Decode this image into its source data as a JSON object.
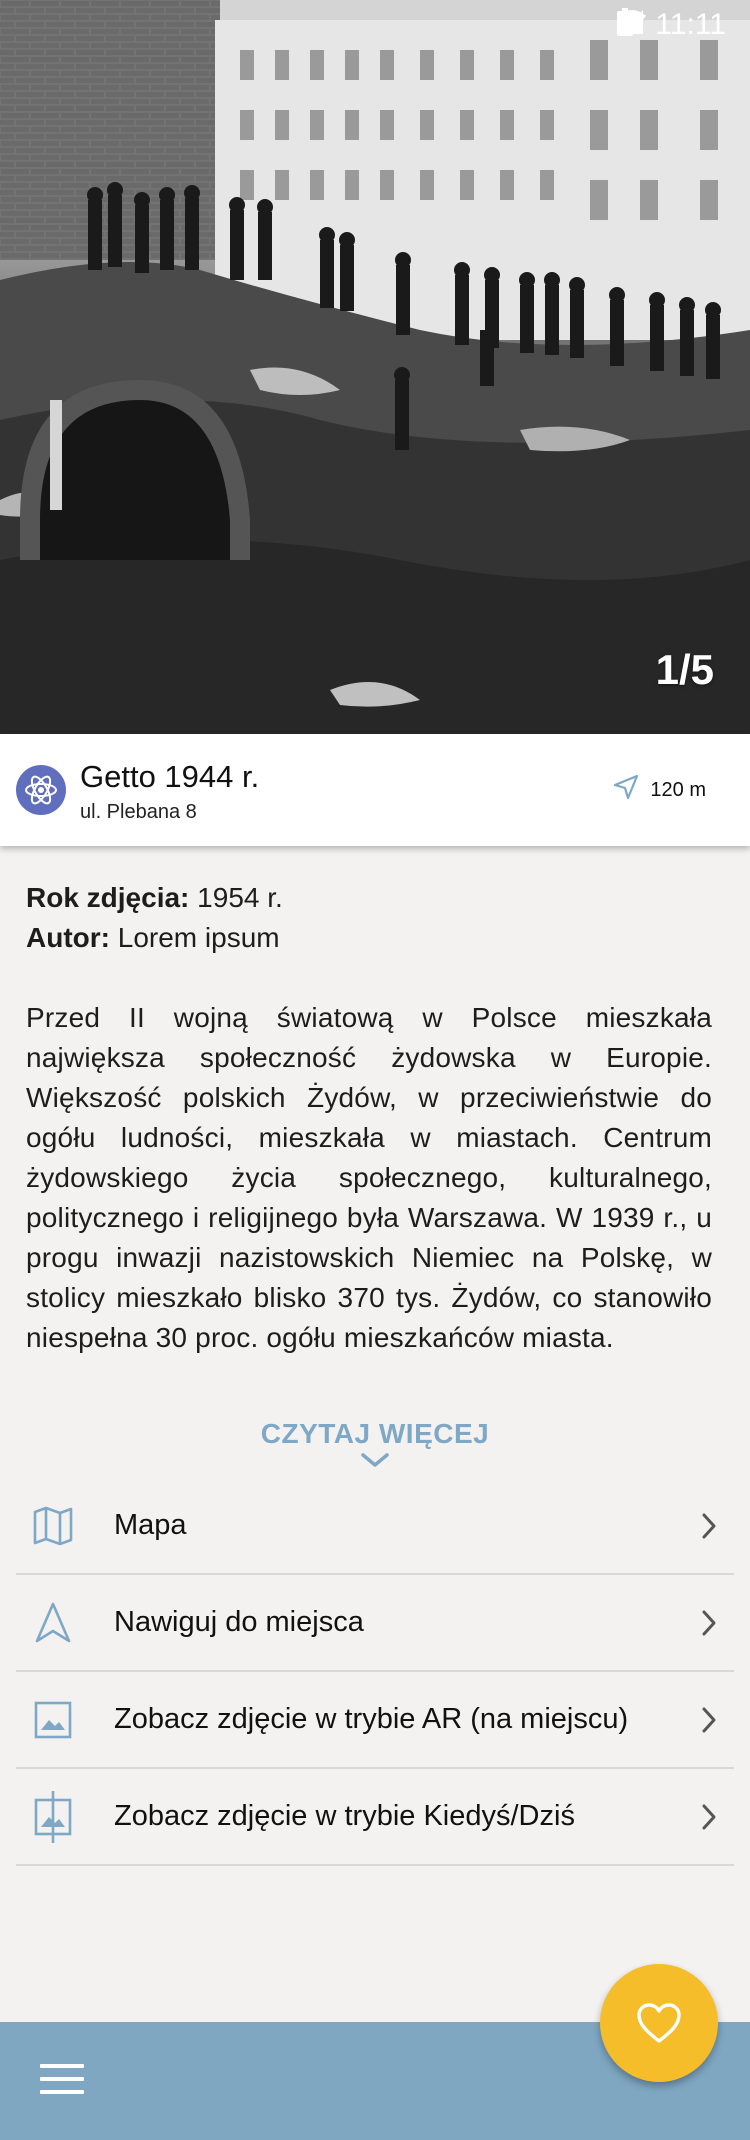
{
  "status_bar": {
    "time": "11:11",
    "icons": [
      "wifi-icon",
      "signal-icon",
      "battery-icon"
    ]
  },
  "photo": {
    "counter": "1/5",
    "description_hint": "historic black-and-white photograph"
  },
  "place": {
    "title": "Getto 1944 r.",
    "address": "ul. Plebana 8",
    "distance": "120 m",
    "logo_icon": "atom-flower-icon"
  },
  "details": {
    "year_label": "Rok zdjęcia:",
    "year_value": "1954 r.",
    "author_label": "Autor:",
    "author_value": "Lorem ipsum",
    "description": "Przed II wojną światową w Polsce mieszkała największa społeczność żydowska w Europie. Większość polskich Żydów, w przeciwieństwie do ogółu ludności, mieszkała w miastach. Centrum żydowskiego życia społecznego, kulturalnego, politycznego i religijnego była Warszawa. W 1939 r., u progu inwazji nazistowskich Niemiec na Polskę, w stolicy mieszkało blisko 370 tys. Żydów, co stanowiło niespełna 30 proc. ogółu mieszkańców miasta."
  },
  "read_more": "CZYTAJ WIĘCEJ",
  "menu": [
    {
      "label": "Mapa",
      "icon": "map-icon"
    },
    {
      "label": "Nawiguj do miejsca",
      "icon": "navigation-arrow-icon"
    },
    {
      "label": "Zobacz zdjęcie w trybie AR (na miejscu)",
      "icon": "image-icon"
    },
    {
      "label": "Zobacz zdjęcie w trybie Kiedyś/Dziś",
      "icon": "image-compare-icon"
    }
  ],
  "colors": {
    "accent": "#7fa7c2",
    "fab": "#f6bd2b",
    "logo": "#5f6fbd"
  }
}
